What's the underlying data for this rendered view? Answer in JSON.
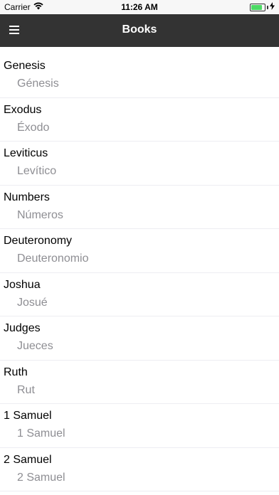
{
  "status_bar": {
    "carrier": "Carrier",
    "time": "11:26 AM",
    "battery_level": 0.85,
    "battery_color": "#4cd964"
  },
  "nav": {
    "title": "Books",
    "menu_icon": "hamburger-menu-icon"
  },
  "books": [
    {
      "en": "Genesis",
      "es": "Génesis"
    },
    {
      "en": "Exodus",
      "es": "Éxodo"
    },
    {
      "en": "Leviticus",
      "es": "Levítico"
    },
    {
      "en": "Numbers",
      "es": "Números"
    },
    {
      "en": "Deuteronomy",
      "es": "Deuteronomio"
    },
    {
      "en": "Joshua",
      "es": "Josué"
    },
    {
      "en": "Judges",
      "es": "Jueces"
    },
    {
      "en": "Ruth",
      "es": "Rut"
    },
    {
      "en": "1 Samuel",
      "es": "1 Samuel"
    },
    {
      "en": "2 Samuel",
      "es": "2 Samuel"
    }
  ]
}
